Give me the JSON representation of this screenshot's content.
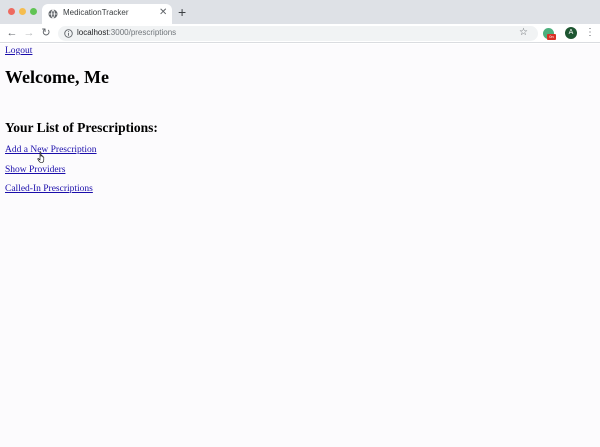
{
  "browser": {
    "tab_title": "MedicationTracker",
    "tab_close": "✕",
    "new_tab": "+",
    "url_host": "localhost",
    "url_path": ":3000/prescriptions",
    "profile_initial": "A",
    "extension_badge": "0n",
    "nav": {
      "back": "←",
      "forward": "→",
      "reload": "↻"
    },
    "star": "☆",
    "menu": "⋮"
  },
  "page": {
    "logout_link": "Logout",
    "welcome": "Welcome, Me",
    "list_heading": "Your List of Prescriptions:",
    "links": {
      "add": "Add a New Prescription",
      "providers": "Show Providers",
      "called_in": "Called-In Prescriptions"
    }
  },
  "colors": {
    "link": "#1a0dab",
    "tabstrip": "#dee1e6",
    "page_bg": "#fcfbfd"
  }
}
